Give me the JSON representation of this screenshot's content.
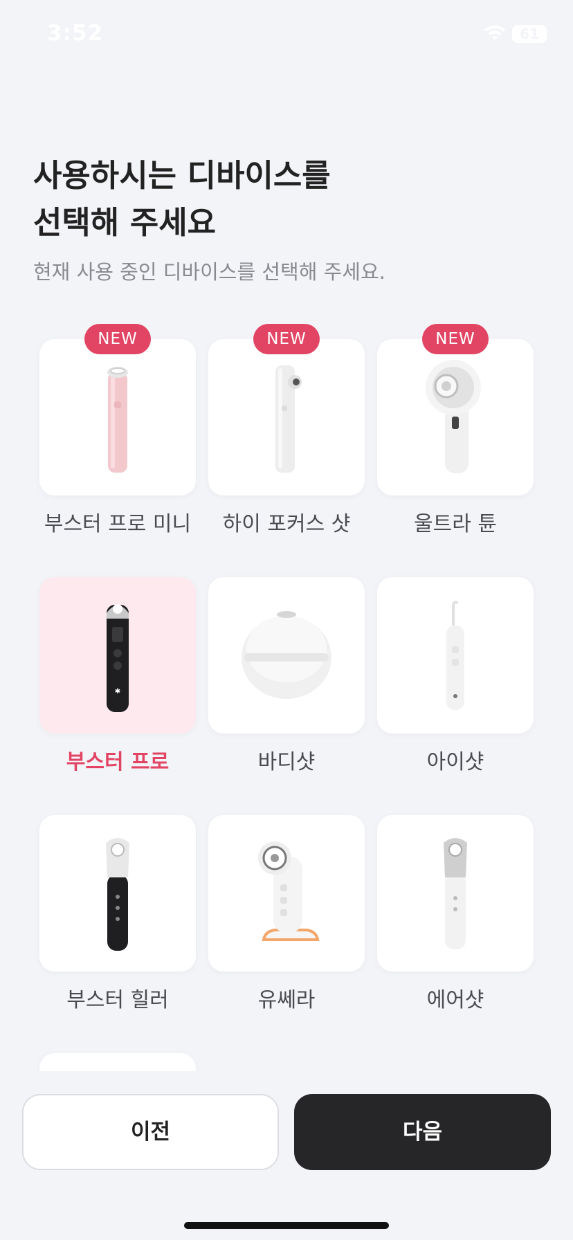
{
  "status_bar": {
    "time": "3:52",
    "battery": "61"
  },
  "header": {
    "title_line1": "사용하시는 디바이스를",
    "title_line2": "선택해 주세요",
    "subtitle": "현재 사용 중인 디바이스를 선택해 주세요."
  },
  "devices": [
    {
      "label": "부스터 프로 미니",
      "badge": "NEW",
      "selected": false,
      "icon": "booster-pro-mini-device"
    },
    {
      "label": "하이 포커스 샷",
      "badge": "NEW",
      "selected": false,
      "icon": "high-focus-shot-device"
    },
    {
      "label": "울트라 튠",
      "badge": "NEW",
      "selected": false,
      "icon": "ultra-tune-device"
    },
    {
      "label": "부스터 프로",
      "badge": "",
      "selected": true,
      "icon": "booster-pro-device"
    },
    {
      "label": "바디샷",
      "badge": "",
      "selected": false,
      "icon": "body-shot-device"
    },
    {
      "label": "아이샷",
      "badge": "",
      "selected": false,
      "icon": "eye-shot-device"
    },
    {
      "label": "부스터 힐러",
      "badge": "",
      "selected": false,
      "icon": "booster-healer-device"
    },
    {
      "label": "유쎄라",
      "badge": "",
      "selected": false,
      "icon": "useera-device"
    },
    {
      "label": "에어샷",
      "badge": "",
      "selected": false,
      "icon": "air-shot-device"
    }
  ],
  "footer": {
    "prev_label": "이전",
    "next_label": "다음"
  },
  "colors": {
    "accent": "#e24564",
    "selected_bg": "#fde9ee",
    "next_bg": "#262528",
    "page_bg": "#f3f4f8"
  }
}
